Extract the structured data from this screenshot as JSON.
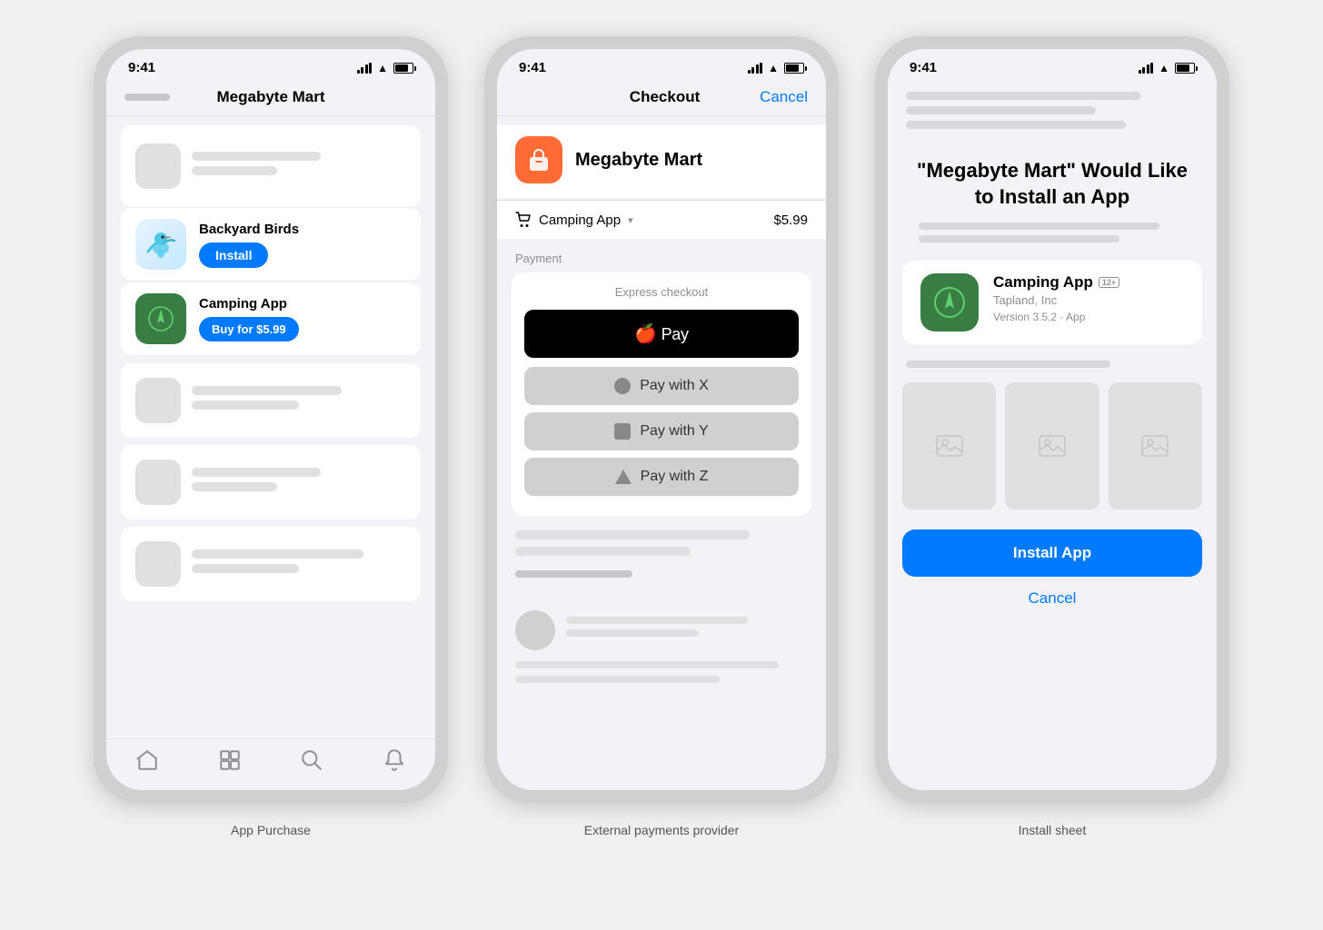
{
  "phones": [
    {
      "id": "app-purchase",
      "label": "App Purchase",
      "status": {
        "time": "9:41",
        "signal": true,
        "wifi": true,
        "battery": true
      },
      "nav": {
        "title": "Megabyte Mart",
        "back_bar": true
      },
      "apps": [
        {
          "name": "Backyard Birds",
          "button_label": "Install",
          "button_type": "install",
          "icon_type": "bird"
        },
        {
          "name": "Camping App",
          "button_label": "Buy for $5.99",
          "button_type": "buy",
          "icon_type": "camping"
        }
      ],
      "tabs": [
        "home",
        "library",
        "search",
        "notifications"
      ]
    },
    {
      "id": "external-payments",
      "label": "External payments provider",
      "status": {
        "time": "9:41",
        "signal": true,
        "wifi": true,
        "battery": true
      },
      "nav": {
        "title": "Checkout",
        "cancel_label": "Cancel"
      },
      "merchant": {
        "name": "Megabyte Mart",
        "icon_type": "orange-bag"
      },
      "cart": {
        "item": "Camping App",
        "price": "$5.99"
      },
      "payment_label": "Payment",
      "express_checkout": {
        "label": "Express checkout",
        "apple_pay_label": " Pay",
        "options": [
          {
            "label": "Pay with X",
            "icon_shape": "circle"
          },
          {
            "label": "Pay with Y",
            "icon_shape": "square"
          },
          {
            "label": "Pay with Z",
            "icon_shape": "triangle"
          }
        ]
      }
    },
    {
      "id": "install-sheet",
      "label": "Install sheet",
      "status": {
        "time": "9:41",
        "signal": true,
        "wifi": true,
        "battery": true
      },
      "install_title": "\"Megabyte Mart\" Would Like to Install an App",
      "app": {
        "name": "Camping App",
        "age_rating": "12+",
        "developer": "Tapland, Inc",
        "version": "Version 3.5.2 · App",
        "icon_type": "camping"
      },
      "install_btn_label": "Install App",
      "cancel_label": "Cancel"
    }
  ]
}
